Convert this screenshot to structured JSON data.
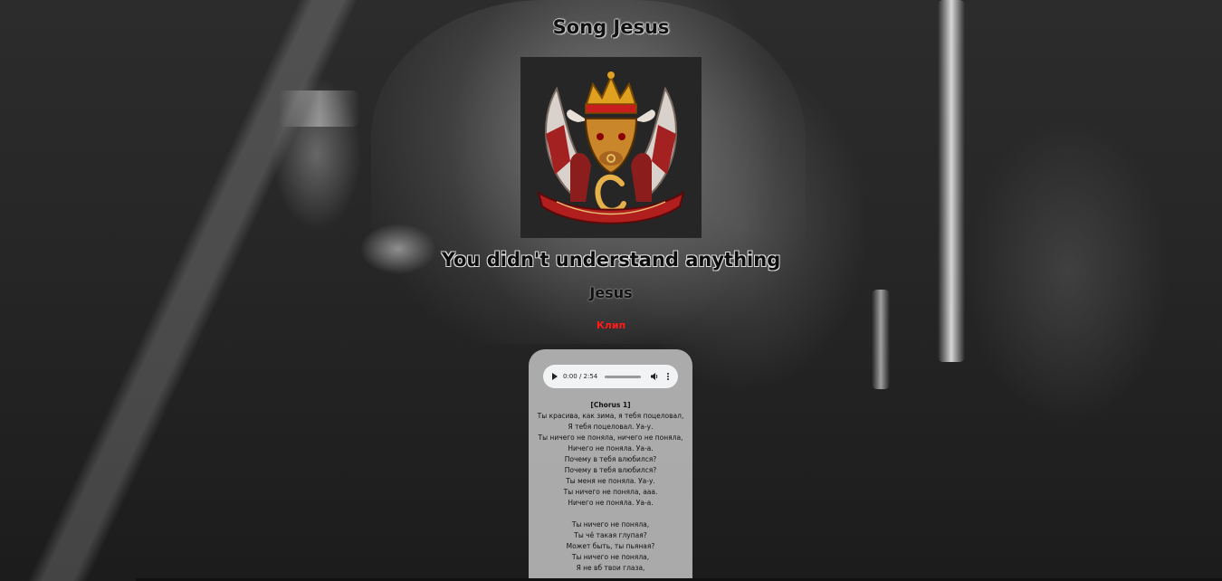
{
  "page": {
    "song_title": "Song Jesus",
    "headline": "You didn't understand anything",
    "artist": "Jesus",
    "clip_link": "Клип"
  },
  "cover": {
    "alt_icon": "crest-album-cover-icon"
  },
  "player": {
    "time": "0:00 / 2:54",
    "progress": 0
  },
  "lyrics": {
    "section": "[Chorus 1]",
    "lines": [
      "Ты красива, как зима, я тебя поцеловал,",
      "Я тебя поцеловал. Уа-у.",
      "Ты ничего не поняла, ничего не поняла,",
      "Ничего не поняла. Уа-а.",
      "Почему в тебя влюбился?",
      "Почему в тебя влюбился?",
      "Ты меня не поняла. Уа-у.",
      "Ты ничего не поняла, ааа.",
      "Ничего не поняла. Уа-а.",
      "",
      "Ты ничего не поняла,",
      "Ты чё такая глупая?",
      "Может быть, ты пьяная?",
      "Ты ничего не поняла,",
      "Я не вб твои глаза,"
    ]
  },
  "colors": {
    "clip_link": "#ff1a1a",
    "card_bg": "#bebebe",
    "player_bg": "#f1f3f4"
  }
}
